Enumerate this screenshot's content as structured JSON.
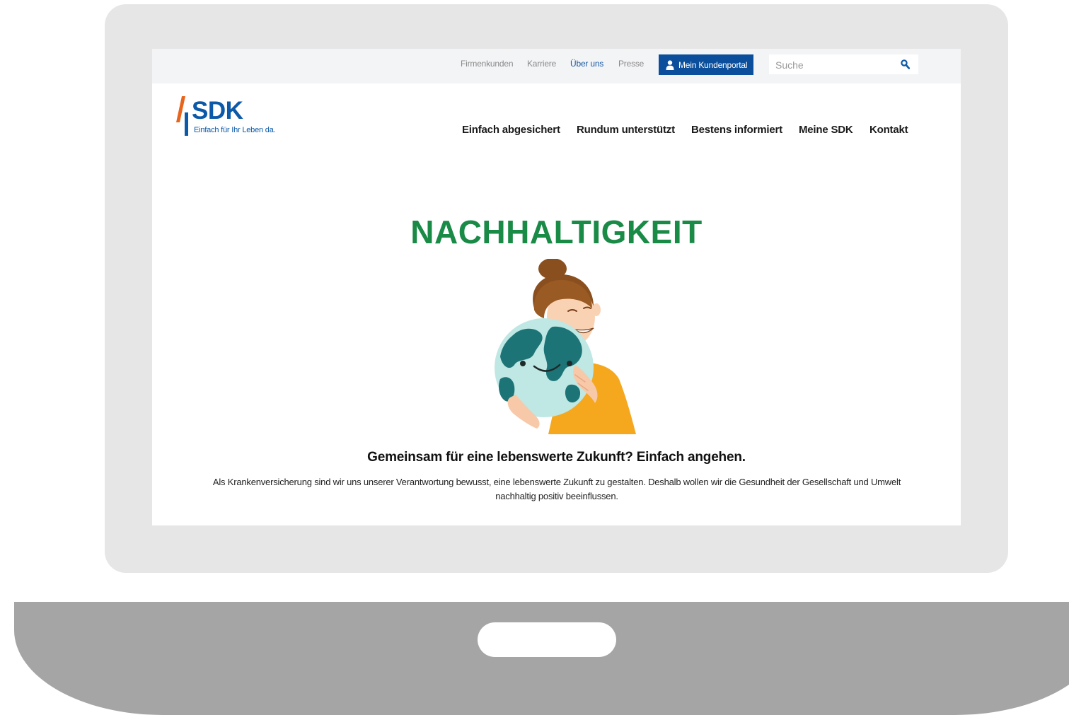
{
  "topbar": {
    "links": [
      {
        "label": "Firmenkunden",
        "active": false
      },
      {
        "label": "Karriere",
        "active": false
      },
      {
        "label": "Über uns",
        "active": true
      },
      {
        "label": "Presse",
        "active": false
      }
    ],
    "portal_button": "Mein Kundenportal",
    "search_placeholder": "Suche",
    "search_value": ""
  },
  "logo": {
    "name": "SDK",
    "tagline": "Einfach für Ihr Leben da."
  },
  "nav": {
    "items": [
      "Einfach abgesichert",
      "Rundum unterstützt",
      "Bestens informiert",
      "Meine SDK",
      "Kontakt"
    ]
  },
  "hero": {
    "title": "NACHHALTIGKEIT",
    "subtitle": "Gemeinsam für eine lebenswerte Zukunft? Einfach angehen.",
    "body": "Als Krankenversicherung sind wir uns unserer Verantwortung bewusst, eine lebenswerte Zukunft zu gestalten. Deshalb wollen wir die Gesundheit der Gesellschaft und Umwelt nachhaltig positiv beeinflussen."
  },
  "colors": {
    "brand_blue": "#0b59a8",
    "button_blue": "#0b4f9c",
    "title_green": "#1a8a47",
    "accent_orange": "#e8641c",
    "laptop_lid": "#e6e6e6",
    "laptop_base": "#a5a5a5"
  },
  "icons": {
    "user": "user-icon",
    "search": "search-icon"
  }
}
